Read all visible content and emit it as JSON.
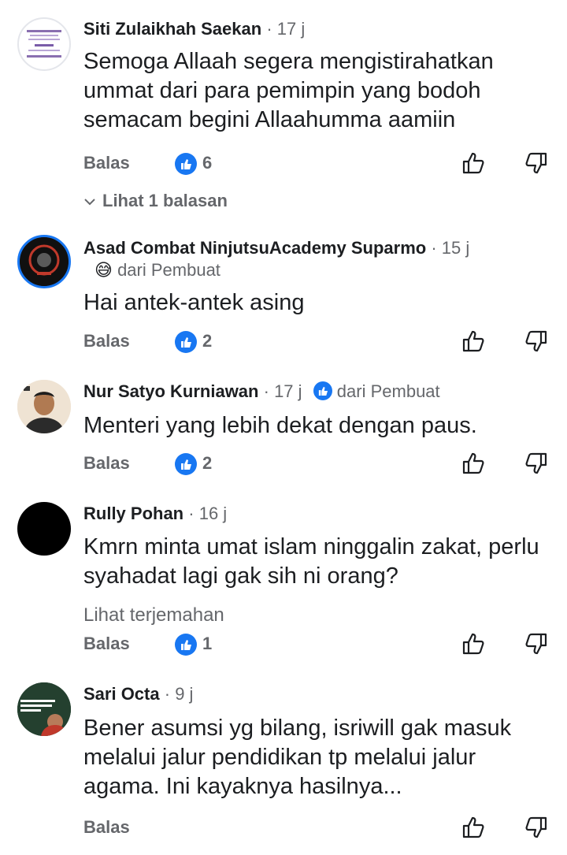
{
  "comments": [
    {
      "author": "Siti Zulaikhah Saekan",
      "time": "17 j",
      "text": "Semoga Allaah segera mengistirahatkan ummat dari para pemimpin yang bodoh semacam begini Allaahumma aamiin",
      "reply_label": "Balas",
      "like_count": "6",
      "view_replies": "Lihat 1 balasan"
    },
    {
      "author": "Asad Combat NinjutsuAcademy Suparmo",
      "time": "15 j",
      "creator_label": "dari Pembuat",
      "creator_icon": "😅",
      "text": "Hai antek-antek asing",
      "reply_label": "Balas",
      "like_count": "2"
    },
    {
      "author": "Nur Satyo Kurniawan",
      "time": "17 j",
      "creator_label": "dari Pembuat",
      "text": "Menteri yang lebih dekat dengan paus.",
      "reply_label": "Balas",
      "like_count": "2"
    },
    {
      "author": "Rully Pohan",
      "time": "16 j",
      "text": "Kmrn minta umat islam ninggalin zakat, perlu syahadat lagi gak sih ni orang?",
      "see_translation": "Lihat terjemahan",
      "reply_label": "Balas",
      "like_count": "1"
    },
    {
      "author": "Sari Octa",
      "time": "9 j",
      "text": "Bener asumsi yg bilang, isriwill gak masuk melalui jalur pendidikan tp melalui jalur agama. Ini kayaknya hasilnya...",
      "reply_label": "Balas"
    }
  ],
  "separator": "·",
  "colors": {
    "like_blue": "#1877f2",
    "secondary_text": "#65676b",
    "primary_text": "#1c1e21"
  },
  "icons": [
    "like-badge-icon",
    "thumbs-up-icon",
    "thumbs-down-icon",
    "chevron-down-icon"
  ]
}
